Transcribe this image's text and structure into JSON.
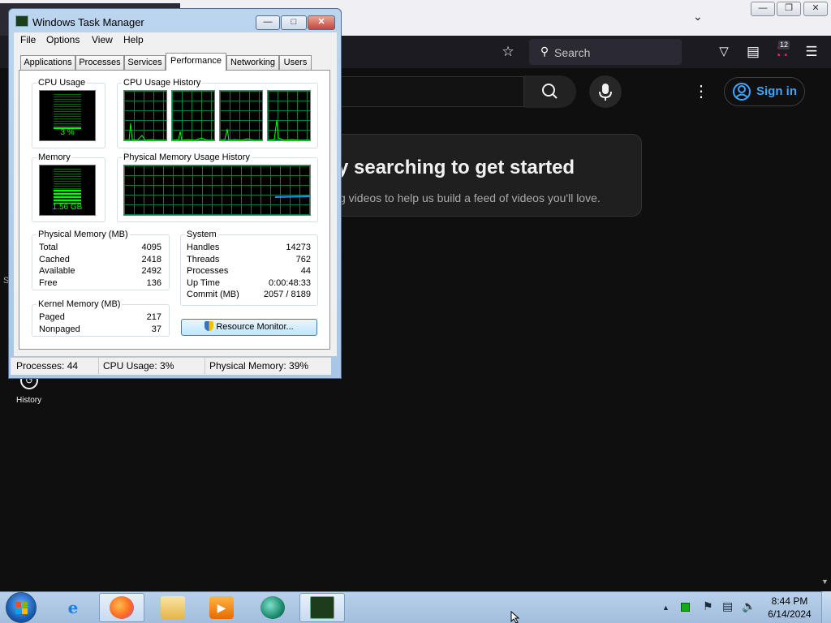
{
  "firefox": {
    "search_placeholder": "Search",
    "notification_count": "12"
  },
  "youtube": {
    "signin_label": "Sign in",
    "card_title": "y searching to get started",
    "card_subtitle": "g videos to help us build a feed of videos you'll love.",
    "sidebar_history": "History",
    "sidebar_partial": "S"
  },
  "task_manager": {
    "title": "Windows Task Manager",
    "menu": [
      "File",
      "Options",
      "View",
      "Help"
    ],
    "tabs": [
      "Applications",
      "Processes",
      "Services",
      "Performance",
      "Networking",
      "Users"
    ],
    "active_tab": "Performance",
    "cpu_usage": {
      "label": "CPU Usage",
      "value": "3 %",
      "percent": 3
    },
    "cpu_history": {
      "label": "CPU Usage History",
      "cores": 4
    },
    "memory": {
      "label": "Memory",
      "value": "1.56 GB",
      "percent": 39
    },
    "memory_history": {
      "label": "Physical Memory Usage History"
    },
    "physical_memory": {
      "label": "Physical Memory (MB)",
      "rows": [
        {
          "name": "Total",
          "value": "4095"
        },
        {
          "name": "Cached",
          "value": "2418"
        },
        {
          "name": "Available",
          "value": "2492"
        },
        {
          "name": "Free",
          "value": "136"
        }
      ]
    },
    "kernel_memory": {
      "label": "Kernel Memory (MB)",
      "rows": [
        {
          "name": "Paged",
          "value": "217"
        },
        {
          "name": "Nonpaged",
          "value": "37"
        }
      ]
    },
    "system": {
      "label": "System",
      "rows": [
        {
          "name": "Handles",
          "value": "14273"
        },
        {
          "name": "Threads",
          "value": "762"
        },
        {
          "name": "Processes",
          "value": "44"
        },
        {
          "name": "Up Time",
          "value": "0:00:48:33"
        },
        {
          "name": "Commit (MB)",
          "value": "2057 / 8189"
        }
      ]
    },
    "resource_monitor_button": "Resource Monitor...",
    "status": {
      "processes": "Processes: 44",
      "cpu": "CPU Usage: 3%",
      "memory": "Physical Memory: 39%"
    }
  },
  "taskbar": {
    "time": "8:44 PM",
    "date": "6/14/2024",
    "apps": [
      "start-menu",
      "internet-explorer",
      "firefox",
      "windows-explorer",
      "media-player",
      "chat-app",
      "task-manager"
    ]
  },
  "colors": {
    "graph_line": "#00ff00",
    "graph_grid": "#008040",
    "memory_history_line": "#1e90ff",
    "youtube_link": "#3ea6ff"
  }
}
